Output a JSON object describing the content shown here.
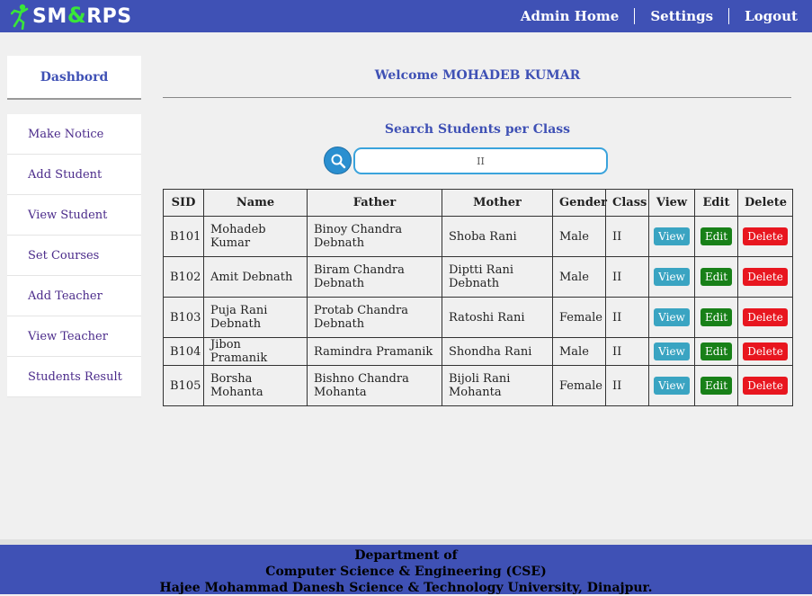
{
  "app": {
    "logo_prefix": "SM",
    "logo_amp": "&",
    "logo_suffix": "RPS"
  },
  "nav": {
    "home": "Admin Home",
    "settings": "Settings",
    "logout": "Logout"
  },
  "sidebar": {
    "heading": "Dashbord",
    "items": [
      {
        "label": "Make Notice"
      },
      {
        "label": "Add Student"
      },
      {
        "label": "View Student"
      },
      {
        "label": "Set Courses"
      },
      {
        "label": "Add Teacher"
      },
      {
        "label": "View Teacher"
      },
      {
        "label": "Students Result"
      }
    ]
  },
  "main": {
    "welcome": "Welcome MOHADEB KUMAR",
    "search_title": "Search Students per Class",
    "search_value": "II"
  },
  "table": {
    "headers": [
      "SID",
      "Name",
      "Father",
      "Mother",
      "Gender",
      "Class",
      "View",
      "Edit",
      "Delete"
    ],
    "action_labels": {
      "view": "View",
      "edit": "Edit",
      "delete": "Delete"
    },
    "rows": [
      {
        "sid": "B101",
        "name": "Mohadeb Kumar",
        "father": "Binoy Chandra Debnath",
        "mother": "Shoba Rani",
        "gender": "Male",
        "class": "II"
      },
      {
        "sid": "B102",
        "name": "Amit Debnath",
        "father": "Biram Chandra Debnath",
        "mother": "Diptti Rani Debnath",
        "gender": "Male",
        "class": "II"
      },
      {
        "sid": "B103",
        "name": "Puja Rani Debnath",
        "father": "Protab Chandra Debnath",
        "mother": "Ratoshi Rani",
        "gender": "Female",
        "class": "II"
      },
      {
        "sid": "B104",
        "name": "Jibon Pramanik",
        "father": "Ramindra Pramanik",
        "mother": "Shondha Rani",
        "gender": "Male",
        "class": "II"
      },
      {
        "sid": "B105",
        "name": "Borsha Mohanta",
        "father": "Bishno Chandra Mohanta",
        "mother": "Bijoli Rani Mohanta",
        "gender": "Female",
        "class": "II"
      }
    ]
  },
  "footer": {
    "line1": "Department of",
    "line2": "Computer Science & Engineering (CSE)",
    "line3": "Hajee Mohammad Danesh Science & Technology University, Dinajpur."
  },
  "colors": {
    "primary": "#3f51b5",
    "view": "#3aa4c2",
    "edit": "#188018",
    "delete": "#e8161f",
    "logo_accent": "#39e639"
  }
}
